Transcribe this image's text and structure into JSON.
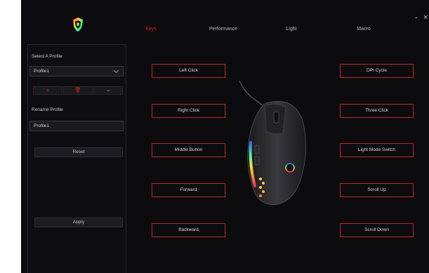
{
  "colors": {
    "accent": "#e1242e",
    "background": "#0c0c0e",
    "panel": "#1b1b1f"
  },
  "icons": {
    "logo": "shield-logo-icon",
    "add": "plus-icon",
    "delete": "trash-icon",
    "remove": "minus-icon",
    "minimize": "minimize-icon",
    "close": "close-icon"
  },
  "nav": {
    "tabs": [
      "Keys",
      "Performance",
      "Light",
      "Macro"
    ],
    "active_tab": "Keys"
  },
  "window": {
    "minimize": "-",
    "close": "×"
  },
  "sidebar": {
    "select_profile_label": "Select A Profile",
    "profile_value": "Profile1",
    "add_glyph": "+",
    "delete_glyph": "🗑",
    "remove_glyph": "−",
    "rename_label": "Rename Profile",
    "rename_value": "Profile1",
    "reset_label": "Reset",
    "apply_label": "Apply"
  },
  "buttons": {
    "left_click": "Left Click",
    "right_click": "Right Click",
    "middle_button": "Middle Button",
    "forward": "Forward",
    "backward": "Backward",
    "dpi_cycle": "DPI Cycle",
    "three_click": "Three Click",
    "light_mode_switch": "Light Mode Switch",
    "scroll_up": "Scroll Up",
    "scroll_down": "Scroll Down"
  }
}
